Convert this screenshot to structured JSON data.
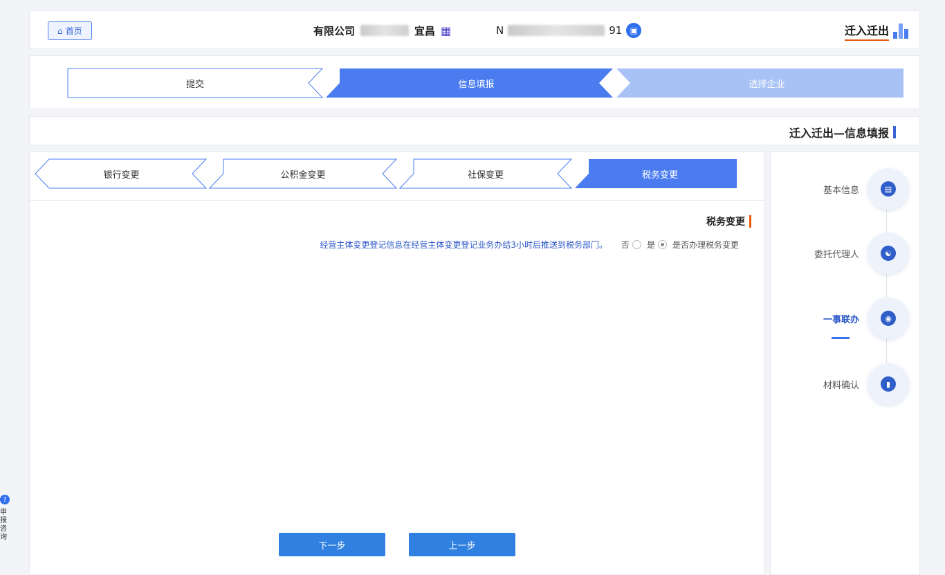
{
  "header": {
    "home_label": "首页",
    "company_prefix": "宜昌",
    "company_suffix": "有限公司",
    "credit_prefix": "91",
    "credit_suffix": "N",
    "brand": "迁入迁出"
  },
  "steps": [
    {
      "label": "选择企业"
    },
    {
      "label": "信息填报"
    },
    {
      "label": "提交"
    }
  ],
  "page_title": "迁入迁出—信息填报",
  "sidebar": {
    "items": [
      {
        "label": "基本信息",
        "icon": "document-icon"
      },
      {
        "label": "委托代理人",
        "icon": "handshake-icon"
      },
      {
        "label": "一事联办",
        "icon": "eye-icon"
      },
      {
        "label": "材料确认",
        "icon": "file-icon"
      }
    ]
  },
  "subtabs": [
    {
      "label": "税务变更"
    },
    {
      "label": "社保变更"
    },
    {
      "label": "公积金变更"
    },
    {
      "label": "银行变更"
    }
  ],
  "section": {
    "title": "税务变更",
    "question": "是否办理税务变更",
    "yes": "是",
    "no": "否",
    "notice": "经营主体变更登记信息在经营主体变更登记业务办结3小时后推送到税务部门。"
  },
  "buttons": {
    "prev": "上一步",
    "next": "下一步"
  },
  "float_widget": {
    "text": "申报咨询"
  },
  "colors": {
    "primary": "#4a7cf0",
    "step_done": "#a9c2f5",
    "accent": "#e8590c",
    "button": "#2f80e0"
  }
}
